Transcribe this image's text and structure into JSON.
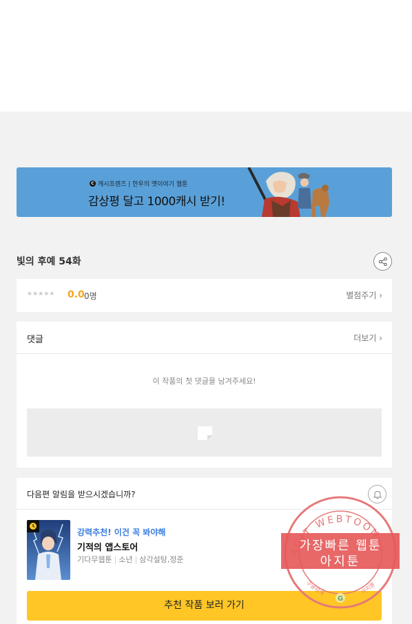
{
  "banner": {
    "logo_letter": "C",
    "subtitle": "캐시프렌즈 | 한우의 옛이야기 웹툰",
    "title": "감상평 달고 1000캐시 받기!"
  },
  "episode": {
    "title": "빛의 후예 54화"
  },
  "rating": {
    "stars": "★★★★★",
    "score": "0.0",
    "count": "0명",
    "rate_link": "별점주기 ›"
  },
  "comments": {
    "label": "댓글",
    "more": "더보기 ›",
    "empty_message": "이 작품의 첫 댓글을 남겨주세요!"
  },
  "notify": {
    "question": "다음편 알림을 받으시겠습니까?"
  },
  "recommendation": {
    "tag": "강력추천! 이건 꼭 봐야해",
    "title": "기적의 앱스토어",
    "meta": [
      "기다무웹툰",
      "소년",
      "삼각설탕,정준"
    ],
    "button": "추천 작품 보러 가기"
  },
  "watermark": {
    "arc_text": "AGIT WEBTOON",
    "line1": "가장빠른 웹툰",
    "line2": "아지툰",
    "bottom_left": "구글검색",
    "bottom_right": "아지툰",
    "logo_letter": "G"
  },
  "colors": {
    "accent_yellow": "#ffc626",
    "score_orange": "#f5a623",
    "link_blue": "#3b7de0",
    "banner_blue": "#5aa0d8",
    "stamp_red": "#e65a5a"
  }
}
